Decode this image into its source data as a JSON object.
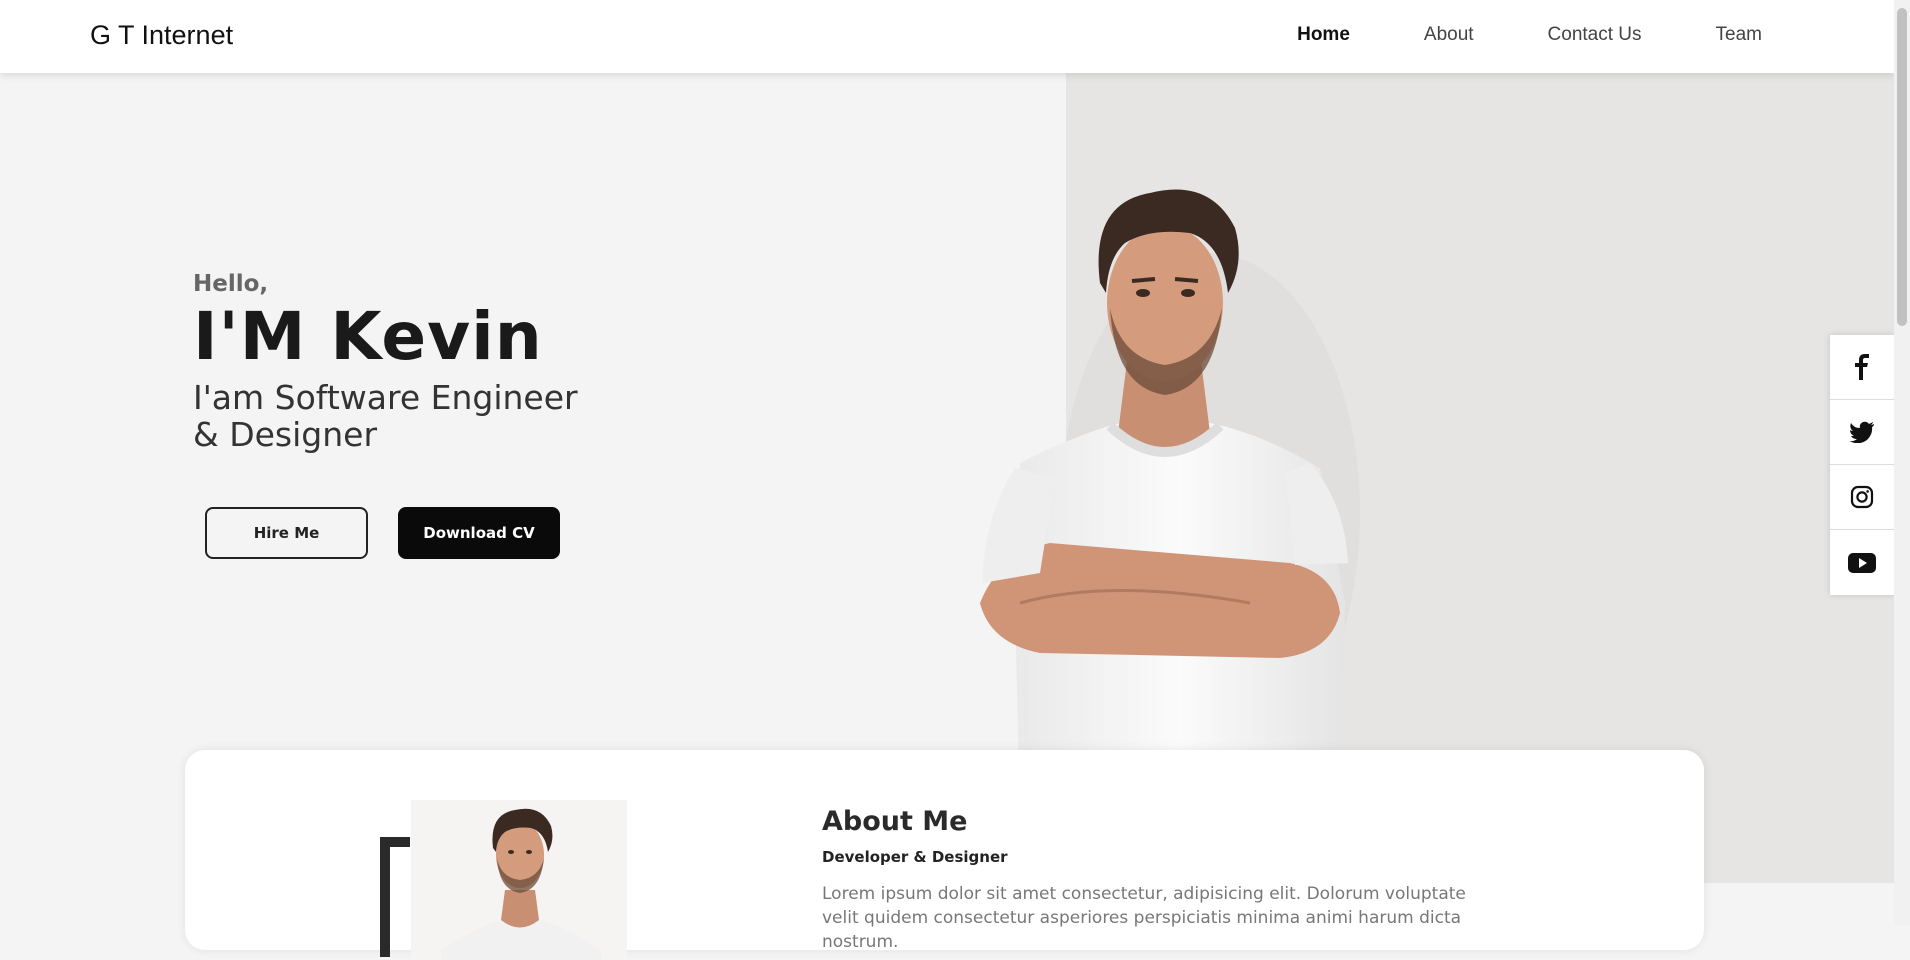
{
  "header": {
    "logo": "G T Internet",
    "nav": [
      {
        "label": "Home",
        "active": true
      },
      {
        "label": "About",
        "active": false
      },
      {
        "label": "Contact Us",
        "active": false
      },
      {
        "label": "Team",
        "active": false
      }
    ]
  },
  "hero": {
    "greeting": "Hello,",
    "name": "I'M Kevin",
    "subtitle_line1": "I'am Software Engineer",
    "subtitle_line2": "& Designer",
    "hire_button": "Hire Me",
    "cv_button": "Download CV"
  },
  "social": [
    {
      "icon": "facebook-icon"
    },
    {
      "icon": "twitter-icon"
    },
    {
      "icon": "instagram-icon"
    },
    {
      "icon": "youtube-icon"
    }
  ],
  "about": {
    "title": "About Me",
    "role": "Developer & Designer",
    "description": "Lorem ipsum dolor sit amet consectetur, adipisicing elit. Dolorum voluptate velit quidem consectetur asperiores perspiciatis minima animi harum dicta nostrum."
  },
  "colors": {
    "background": "#f4f4f4",
    "panel": "#e6e5e3",
    "dark": "#0a0a0a"
  }
}
